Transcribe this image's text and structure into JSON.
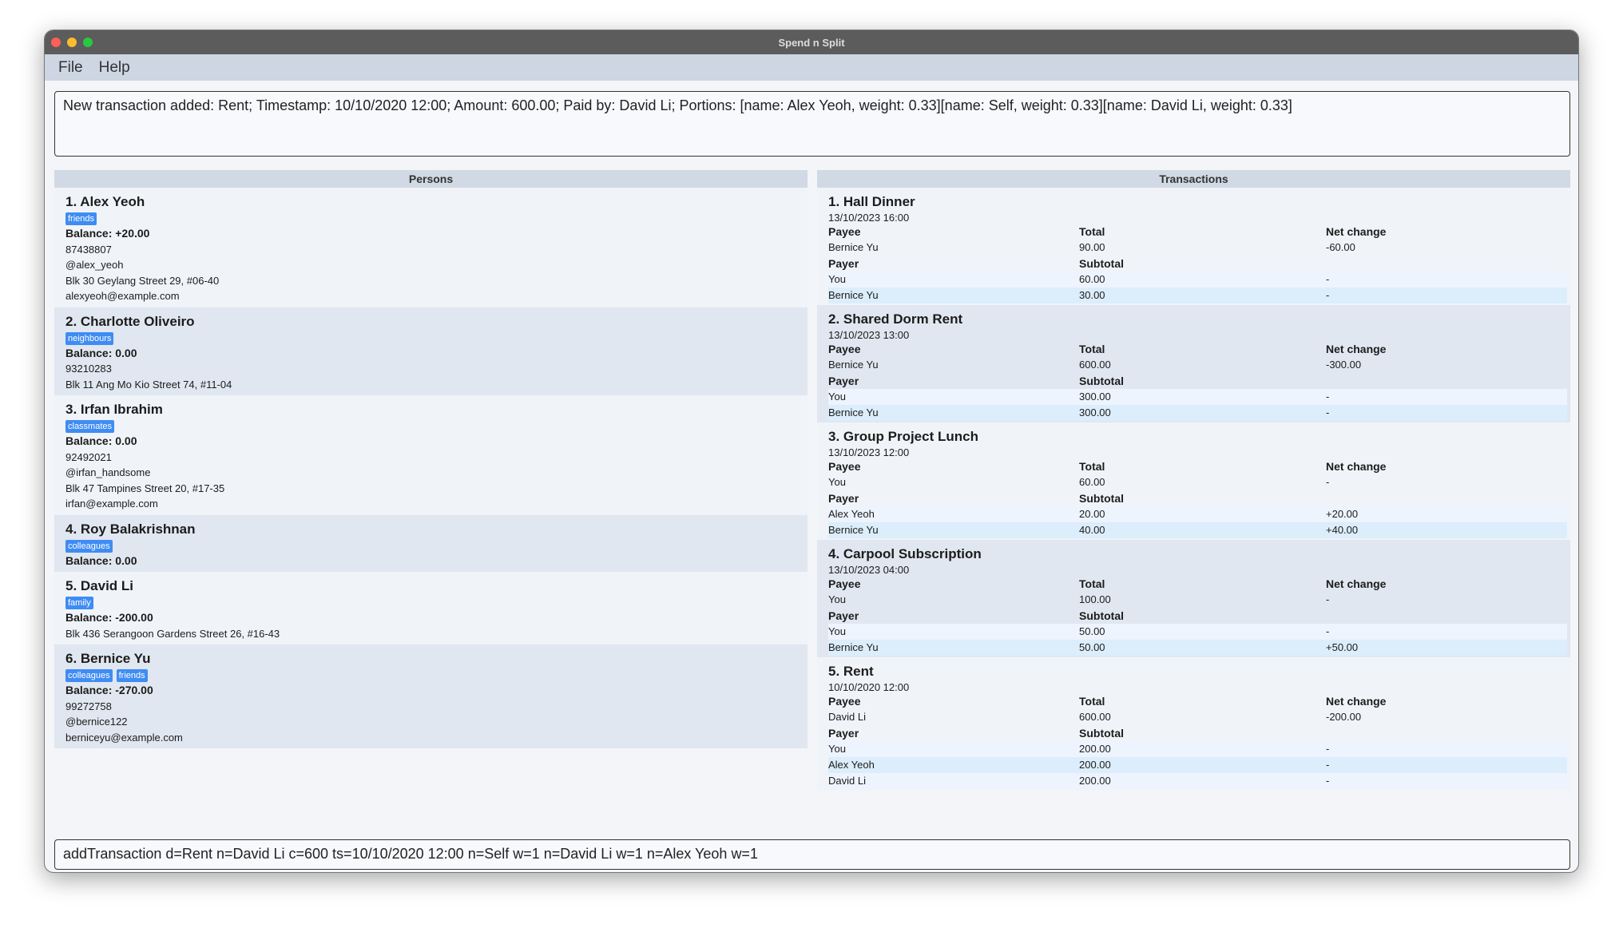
{
  "window": {
    "title": "Spend n Split"
  },
  "menu": [
    "File",
    "Help"
  ],
  "result": "New transaction added: Rent; Timestamp: 10/10/2020 12:00; Amount: 600.00; Paid by: David Li; Portions: [name: Alex Yeoh, weight: 0.33][name: Self, weight: 0.33][name: David Li, weight: 0.33]",
  "persons_header": "Persons",
  "transactions_header": "Transactions",
  "persons": [
    {
      "name": "1.  Alex Yeoh",
      "tags": [
        "friends"
      ],
      "balance": "Balance: +20.00",
      "lines": [
        "87438807",
        "@alex_yeoh",
        "Blk 30 Geylang Street 29, #06-40",
        "alexyeoh@example.com"
      ]
    },
    {
      "name": "2.  Charlotte Oliveiro",
      "tags": [
        "neighbours"
      ],
      "balance": "Balance: 0.00",
      "lines": [
        "93210283",
        "Blk 11 Ang Mo Kio Street 74, #11-04"
      ]
    },
    {
      "name": "3.  Irfan Ibrahim",
      "tags": [
        "classmates"
      ],
      "balance": "Balance: 0.00",
      "lines": [
        "92492021",
        "@irfan_handsome",
        "Blk 47 Tampines Street 20, #17-35",
        "irfan@example.com"
      ]
    },
    {
      "name": "4.  Roy Balakrishnan",
      "tags": [
        "colleagues"
      ],
      "balance": "Balance: 0.00",
      "lines": []
    },
    {
      "name": "5.  David Li",
      "tags": [
        "family"
      ],
      "balance": "Balance: -200.00",
      "lines": [
        "Blk 436 Serangoon Gardens Street 26, #16-43"
      ]
    },
    {
      "name": "6.  Bernice Yu",
      "tags": [
        "colleagues",
        "friends"
      ],
      "balance": "Balance: -270.00",
      "lines": [
        "99272758",
        "@bernice122",
        "berniceyu@example.com"
      ]
    }
  ],
  "labels": {
    "payee": "Payee",
    "total": "Total",
    "net": "Net change",
    "payer": "Payer",
    "subtotal": "Subtotal"
  },
  "transactions": [
    {
      "title": "1.  Hall Dinner",
      "time": "13/10/2023 16:00",
      "payee": [
        "Bernice Yu",
        "90.00",
        "-60.00"
      ],
      "payers": [
        [
          "You",
          "60.00",
          "-"
        ],
        [
          "Bernice Yu",
          "30.00",
          "-"
        ]
      ]
    },
    {
      "title": "2.  Shared Dorm Rent",
      "time": "13/10/2023 13:00",
      "payee": [
        "Bernice Yu",
        "600.00",
        "-300.00"
      ],
      "payers": [
        [
          "You",
          "300.00",
          "-"
        ],
        [
          "Bernice Yu",
          "300.00",
          "-"
        ]
      ]
    },
    {
      "title": "3.  Group Project Lunch",
      "time": "13/10/2023 12:00",
      "payee": [
        "You",
        "60.00",
        "-"
      ],
      "payers": [
        [
          "Alex Yeoh",
          "20.00",
          "+20.00"
        ],
        [
          "Bernice Yu",
          "40.00",
          "+40.00"
        ]
      ]
    },
    {
      "title": "4.  Carpool Subscription",
      "time": "13/10/2023 04:00",
      "payee": [
        "You",
        "100.00",
        "-"
      ],
      "payers": [
        [
          "You",
          "50.00",
          "-"
        ],
        [
          "Bernice Yu",
          "50.00",
          "+50.00"
        ]
      ]
    },
    {
      "title": "5.  Rent",
      "time": "10/10/2020 12:00",
      "payee": [
        "David Li",
        "600.00",
        "-200.00"
      ],
      "payers": [
        [
          "You",
          "200.00",
          "-"
        ],
        [
          "Alex Yeoh",
          "200.00",
          "-"
        ],
        [
          "David Li",
          "200.00",
          "-"
        ]
      ]
    }
  ],
  "command": "addTransaction d=Rent n=David Li c=600 ts=10/10/2020 12:00 n=Self w=1 n=David Li w=1 n=Alex Yeoh w=1",
  "colors": {
    "tag": "#3f8cf3",
    "titlebar": "#5c5c5c",
    "menubar": "#cdd6e2"
  }
}
